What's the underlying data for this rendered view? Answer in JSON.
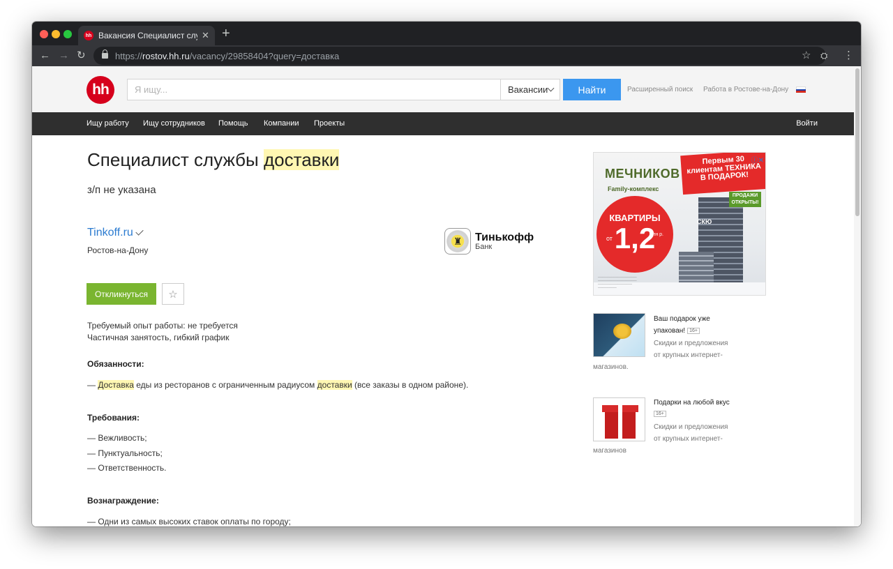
{
  "browser": {
    "tab_title": "Вакансия Специалист службы доставки",
    "tab_favicon": "hh",
    "url_scheme": "https://",
    "url_host": "rostov.hh.ru",
    "url_path": "/vacancy/29858404?query=доставка"
  },
  "header": {
    "logo": "hh",
    "search_placeholder": "Я ищу...",
    "search_type": "Вакансии",
    "search_button": "Найти",
    "advanced_search": "Расширенный поиск",
    "region_link": "Работа в Ростове-на-Дону"
  },
  "nav": {
    "items": [
      "Ищу работу",
      "Ищу сотрудников",
      "Помощь",
      "Компании",
      "Проекты"
    ],
    "login": "Войти"
  },
  "vacancy": {
    "title_plain": "Специалист службы ",
    "title_highlight": "доставки",
    "salary": "з/п не указана",
    "company": "Tinkoff.ru",
    "city": "Ростов-на-Дону",
    "company_logo_name": "Тинькофф",
    "company_logo_sub": "Банк",
    "respond_button": "Откликнуться",
    "experience": "Требуемый опыт работы: не требуется",
    "employment": "Частичная занятость, гибкий график",
    "duties_heading": "Обязанности:",
    "duty_1_prefix": "— ",
    "duty_1_hl1": "Доставка",
    "duty_1_mid": " еды из ресторанов с ограниченным радиусом ",
    "duty_1_hl2": "доставки",
    "duty_1_end": " (все заказы в одном районе).",
    "req_heading": "Требования:",
    "requirements": [
      "— Вежливость;",
      "— Пунктуальность;",
      "— Ответственность."
    ],
    "reward_heading": "Вознаграждение:",
    "reward_1": "— Одни из самых высоких ставок оплаты по городу;"
  },
  "ads": {
    "banner": {
      "brand": "МЕЧНИКОВ",
      "family": "Family-комплекс",
      "ribbon": "Первым 30 клиентам ТЕХНИКА В ПОДАРОК!",
      "sale": "ПРОДАЖИ ОТКРЫТЫ!",
      "flats": "КВАРТИРЫ",
      "from": "от",
      "price": "1,2",
      "unit": "млн р.",
      "developer": "СКЮ"
    },
    "card1": {
      "title_1": "Ваш подарок уже",
      "title_2": "упакован!",
      "age": "16+",
      "desc_1": "Скидки и предложения",
      "desc_2": "от крупных интернет-",
      "desc_3": "магазинов."
    },
    "card2": {
      "title_1": "Подарки на любой вкус",
      "age": "16+",
      "desc_1": "Скидки и предложения",
      "desc_2": "от крупных интернет-",
      "desc_3": "магазинов"
    }
  },
  "colors": {
    "brand_red": "#d6001c",
    "search_blue": "#3b97ef",
    "respond_green": "#7ab530",
    "link_blue": "#2b7bd0",
    "highlight": "#fff7b2"
  }
}
